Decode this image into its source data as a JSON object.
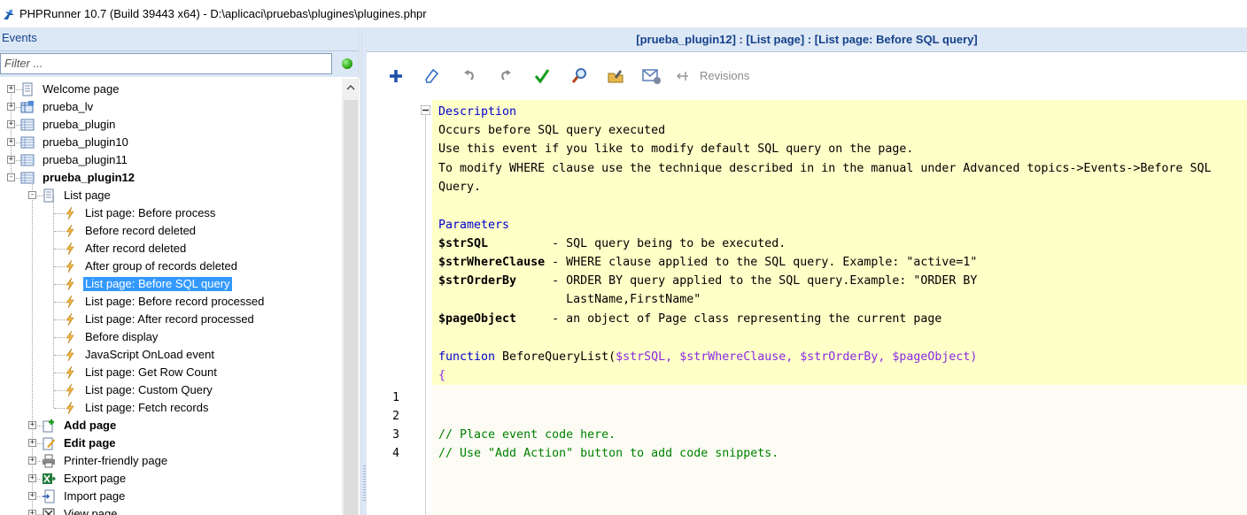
{
  "window": {
    "title": "PHPRunner 10.7 (Build 39443 x64) - D:\\aplicaci\\pruebas\\plugines\\plugines.phpr"
  },
  "left": {
    "header": "Events",
    "filter_placeholder": "Filter ...",
    "tree": [
      {
        "label": "Welcome page",
        "level": 0,
        "icon": "page-icon",
        "expander": "+",
        "bold": false
      },
      {
        "label": "prueba_lv",
        "level": 0,
        "icon": "view-table-icon",
        "expander": "+",
        "bold": false
      },
      {
        "label": "prueba_plugin",
        "level": 0,
        "icon": "table-icon",
        "expander": "+",
        "bold": false
      },
      {
        "label": "prueba_plugin10",
        "level": 0,
        "icon": "table-icon",
        "expander": "+",
        "bold": false
      },
      {
        "label": "prueba_plugin11",
        "level": 0,
        "icon": "table-icon",
        "expander": "+",
        "bold": false
      },
      {
        "label": "prueba_plugin12",
        "level": 0,
        "icon": "table-icon",
        "expander": "-",
        "bold": true
      },
      {
        "label": "List page",
        "level": 1,
        "icon": "page-icon",
        "expander": "-",
        "bold": false
      },
      {
        "label": "List page: Before process",
        "level": 2,
        "icon": "event-icon",
        "expander": "",
        "bold": false
      },
      {
        "label": "Before record deleted",
        "level": 2,
        "icon": "event-icon",
        "expander": "",
        "bold": false
      },
      {
        "label": "After record deleted",
        "level": 2,
        "icon": "event-icon",
        "expander": "",
        "bold": false
      },
      {
        "label": "After group of records deleted",
        "level": 2,
        "icon": "event-icon",
        "expander": "",
        "bold": false
      },
      {
        "label": "List page: Before SQL query",
        "level": 2,
        "icon": "event-icon",
        "expander": "",
        "bold": false,
        "selected": true
      },
      {
        "label": "List page: Before record processed",
        "level": 2,
        "icon": "event-icon",
        "expander": "",
        "bold": false
      },
      {
        "label": "List page: After record processed",
        "level": 2,
        "icon": "event-icon",
        "expander": "",
        "bold": false
      },
      {
        "label": "Before display",
        "level": 2,
        "icon": "event-icon",
        "expander": "",
        "bold": false
      },
      {
        "label": "JavaScript OnLoad event",
        "level": 2,
        "icon": "event-icon",
        "expander": "",
        "bold": false
      },
      {
        "label": "List page: Get Row Count",
        "level": 2,
        "icon": "event-icon",
        "expander": "",
        "bold": false
      },
      {
        "label": "List page: Custom Query",
        "level": 2,
        "icon": "event-icon",
        "expander": "",
        "bold": false
      },
      {
        "label": "List page: Fetch records",
        "level": 2,
        "icon": "event-icon",
        "expander": "",
        "bold": false
      },
      {
        "label": "Add page",
        "level": 1,
        "icon": "add-page-icon",
        "expander": "+",
        "bold": true
      },
      {
        "label": "Edit page",
        "level": 1,
        "icon": "edit-page-icon",
        "expander": "+",
        "bold": true
      },
      {
        "label": "Printer-friendly page",
        "level": 1,
        "icon": "printer-icon",
        "expander": "+",
        "bold": false
      },
      {
        "label": "Export page",
        "level": 1,
        "icon": "export-icon",
        "expander": "+",
        "bold": false
      },
      {
        "label": "Import page",
        "level": 1,
        "icon": "import-icon",
        "expander": "+",
        "bold": false
      },
      {
        "label": "View page",
        "level": 1,
        "icon": "view-icon",
        "expander": "+",
        "bold": false
      }
    ]
  },
  "right": {
    "header": "[prueba_plugin12] : [List page] : [List page: Before SQL query]",
    "toolbar": {
      "buttons": [
        "add-icon",
        "eraser-icon",
        "undo-icon",
        "redo-icon",
        "check-icon",
        "search-icon",
        "edit-folder-icon",
        "email-settings-icon"
      ],
      "revisions_label": "Revisions"
    },
    "doc": {
      "description_title": "Description",
      "description_lines": [
        "Occurs before SQL query executed",
        "Use this event if you like to modify default SQL query on the page.",
        "To modify WHERE clause use the technique described in in the manual under Advanced topics->Events->Before SQL",
        "Query."
      ],
      "parameters_title": "Parameters",
      "params": [
        {
          "name": "$strSQL",
          "pad": "         ",
          "desc": "- SQL query being to be executed."
        },
        {
          "name": "$strWhereClause",
          "pad": " ",
          "desc": "- WHERE clause applied to the SQL query. Example: \"active=1\""
        },
        {
          "name": "$strOrderBy",
          "pad": "     ",
          "desc": "- ORDER BY query applied to the SQL query.Example: \"ORDER BY"
        },
        {
          "name": "",
          "pad": "                  ",
          "desc": "LastName,FirstName\""
        },
        {
          "name": "$pageObject",
          "pad": "     ",
          "desc": "- an object of Page class representing the current page"
        }
      ]
    },
    "code": {
      "function_keyword": "function",
      "function_sig": " BeforeQueryList(",
      "args": "$strSQL, $strWhereClause, $strOrderBy, $pageObject",
      "close_paren": ")",
      "open_brace": "{",
      "line_numbers": [
        "1",
        "2",
        "3",
        "4"
      ],
      "lines": [
        "",
        "",
        "// Place event code here.",
        "// Use \"Add Action\" button to add code snippets."
      ]
    }
  }
}
